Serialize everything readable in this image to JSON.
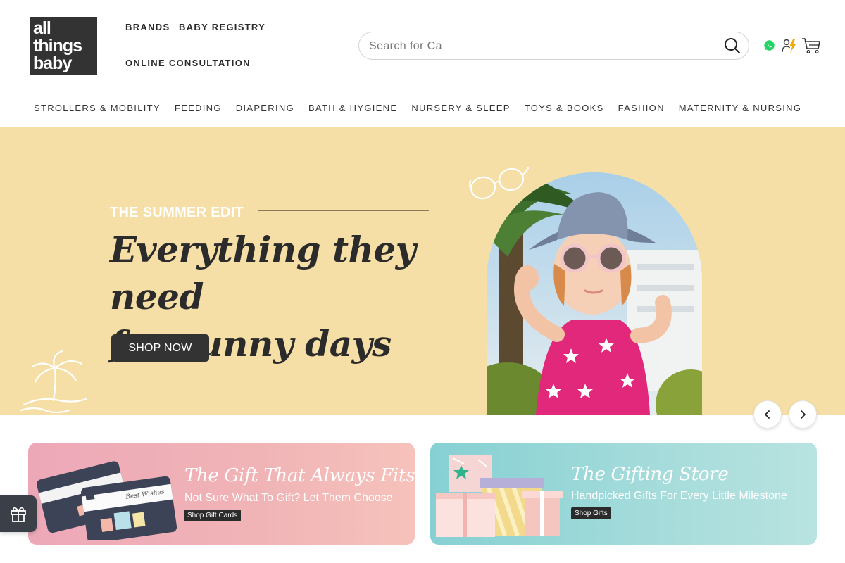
{
  "logo": {
    "lines": [
      "all",
      "things",
      "baby"
    ],
    "tm": "™"
  },
  "top_links": {
    "brands": "BRANDS",
    "baby_registry": "BABY REGISTRY",
    "online_consultation": "ONLINE CONSULTATION"
  },
  "search": {
    "placeholder": "Search for Ca"
  },
  "header_icons": [
    "whatsapp-icon",
    "consultation-icon",
    "cart-icon"
  ],
  "categories": [
    "STROLLERS & MOBILITY",
    "FEEDING",
    "DIAPERING",
    "BATH & HYGIENE",
    "NURSERY & SLEEP",
    "TOYS & BOOKS",
    "FASHION",
    "MATERNITY & NURSING"
  ],
  "hero": {
    "eyebrow": "THE SUMMER EDIT",
    "title_line1": "Everything they need",
    "title_line2": "for sunny days",
    "cta": "SHOP NOW"
  },
  "promos": [
    {
      "title": "The Gift That Always Fits",
      "subtitle": "Not Sure What To Gift? Let Them Choose",
      "button": "Shop Gift Cards",
      "card_text": "Best Wishes"
    },
    {
      "title": "The Gifting Store",
      "subtitle": "Handpicked Gifts For Every Little Milestone",
      "button": "Shop Gifts"
    }
  ],
  "colors": {
    "hero_bg": "#f5dfa6",
    "dark": "#333333",
    "promo_pink": "#f0b4b6",
    "promo_teal": "#a6dcdb",
    "whatsapp": "#25d366"
  }
}
